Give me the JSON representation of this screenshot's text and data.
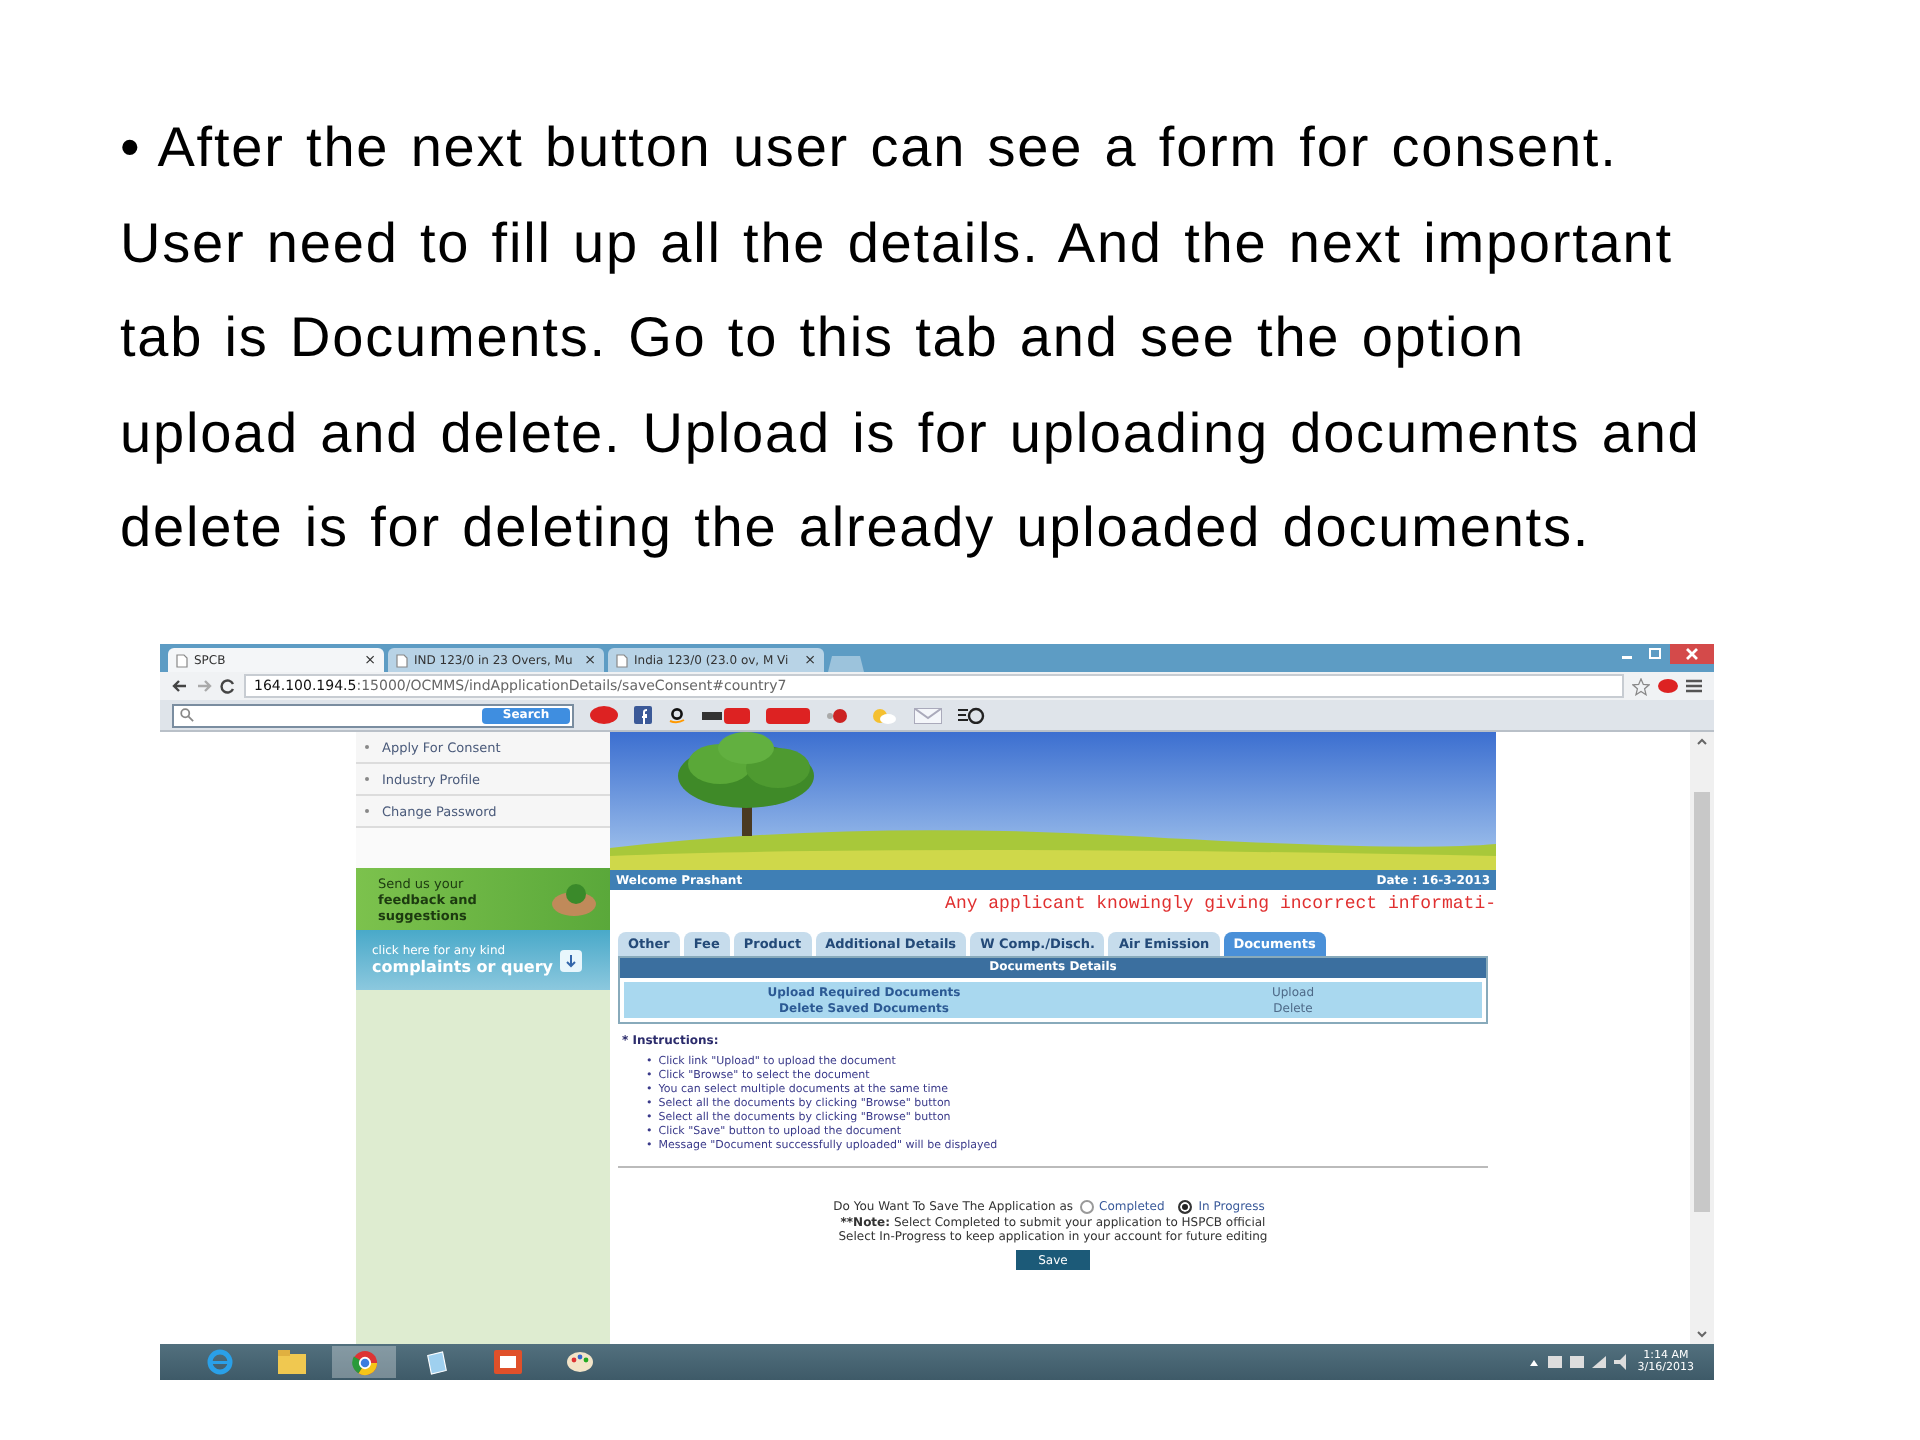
{
  "slide": {
    "bullet": "•",
    "text": "After the next button user can see a form for consent. User need to fill up all the details. And the next important tab is Documents. Go to this tab and see the option upload and delete. Upload is for uploading documents and delete is for deleting the already uploaded documents."
  },
  "browser": {
    "tabs": [
      {
        "title": "SPCB",
        "close": "×",
        "selected": true
      },
      {
        "title": "IND 123/0 in 23 Overs, Mu",
        "close": "×",
        "selected": false
      },
      {
        "title": "India 123/0 (23.0 ov, M Vi",
        "close": "×",
        "selected": false
      }
    ],
    "address": {
      "host": "164.100.194.5",
      "path": ":15000/OCMMS/indApplicationDetails/saveConsent#country7"
    },
    "search_button": "Search"
  },
  "sidebar": {
    "items": [
      "Apply For Consent",
      "Industry Profile",
      "Change Password"
    ],
    "feedback": "Send us your **feedback and suggestions**",
    "complaints_small": "click here for any kind",
    "complaints_big": "complaints or query"
  },
  "page": {
    "welcome": "Welcome Prashant",
    "date": "Date : 16-3-2013",
    "notice": "Any applicant knowingly giving incorrect informati-",
    "tabs": [
      {
        "label": "Other",
        "selected": false
      },
      {
        "label": "Fee",
        "selected": false
      },
      {
        "label": "Product",
        "selected": false
      },
      {
        "label": "Additional Details",
        "selected": false
      },
      {
        "label": "W Comp./Disch.",
        "selected": false
      },
      {
        "label": "Air Emission",
        "selected": false
      },
      {
        "label": "Documents",
        "selected": true
      }
    ],
    "table": {
      "title": "Documents Details",
      "rows": [
        {
          "label": "Upload Required Documents",
          "action": "Upload"
        },
        {
          "label": "Delete Saved Documents",
          "action": "Delete"
        }
      ]
    },
    "instructions_title": "* Instructions:",
    "bullet": "•",
    "instructions": [
      "Click link \"Upload\" to upload the document",
      "Click \"Browse\" to select the document",
      "You can select multiple documents at the same time",
      "Select all the documents by clicking \"Browse\" button",
      "Select all the documents by clicking \"Browse\" button",
      "Click \"Save\" button to upload the document",
      "Message \"Document successfully uploaded\" will be displayed"
    ],
    "question": "Do You Want To Save The Application as",
    "options": [
      {
        "label": "Completed",
        "selected": false
      },
      {
        "label": "In Progress",
        "selected": true
      }
    ],
    "note_label": "**Note:",
    "note_lines": [
      "Select Completed to submit your application to HSPCB official",
      "Select In-Progress to keep application in your account for future editing"
    ],
    "save": "Save"
  },
  "taskbar": {
    "apps": [
      {
        "kind": "ie",
        "selected": false
      },
      {
        "kind": "folder",
        "selected": false
      },
      {
        "kind": "chrome",
        "selected": true
      },
      {
        "kind": "notes",
        "selected": false
      },
      {
        "kind": "slides",
        "selected": false
      },
      {
        "kind": "paint",
        "selected": false
      }
    ],
    "time": "1:14 AM",
    "date": "3/16/2013"
  }
}
